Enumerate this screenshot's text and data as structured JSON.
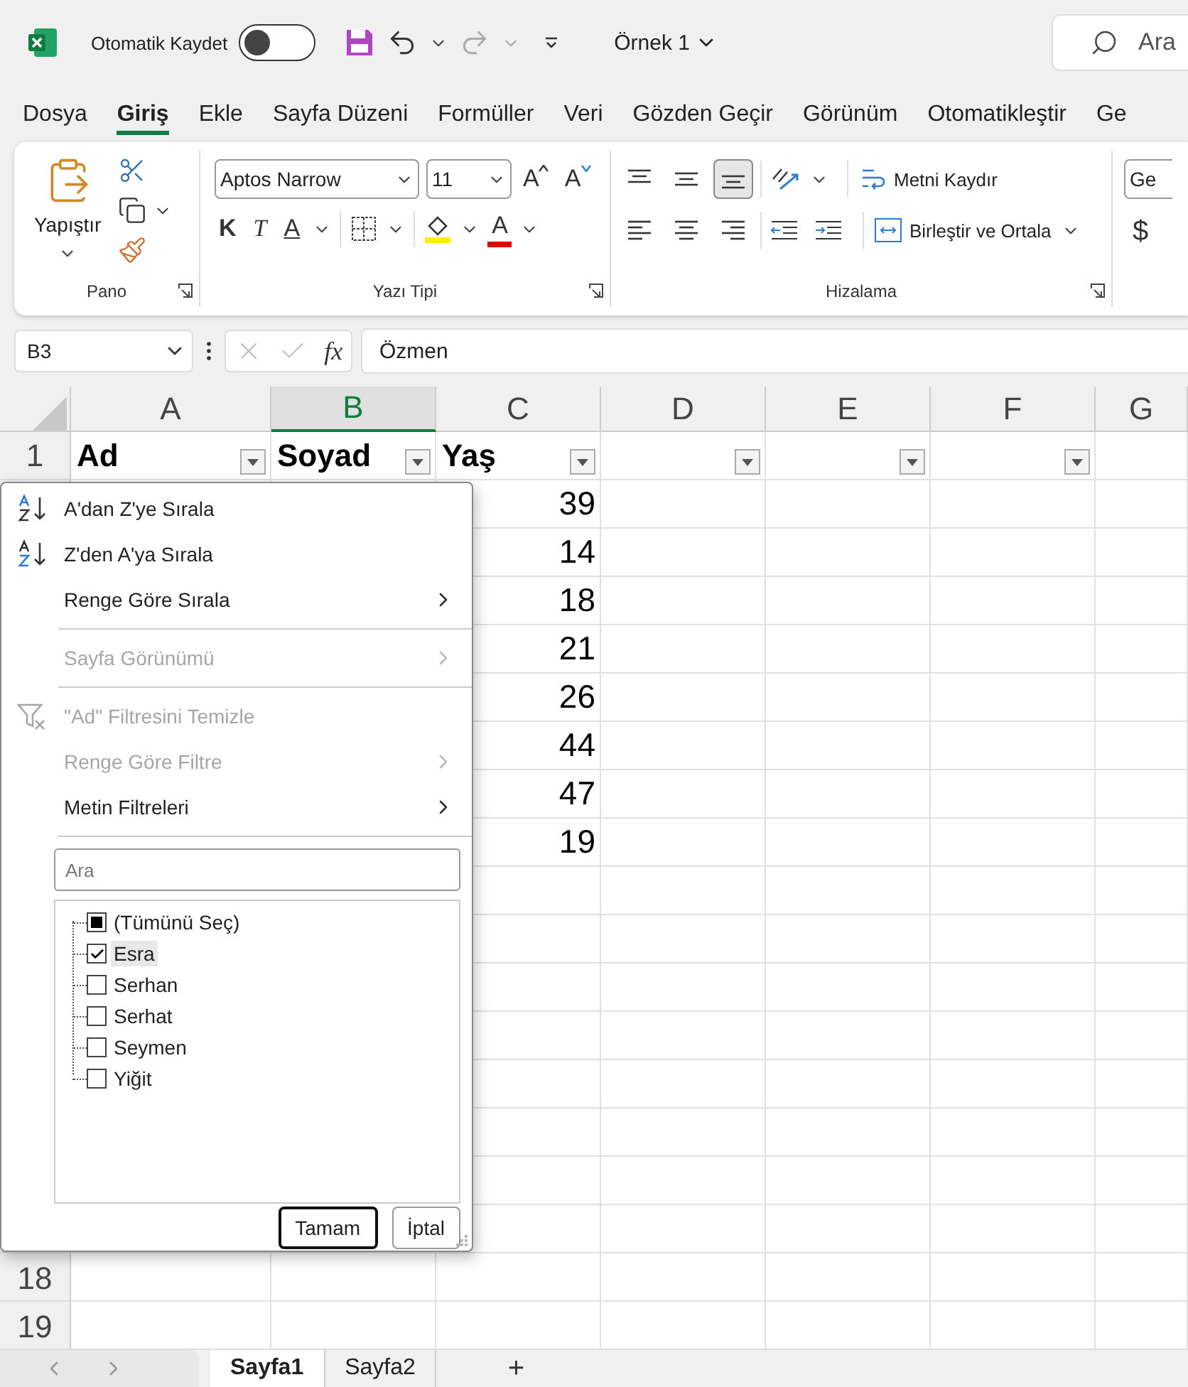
{
  "title_bar": {
    "autosave_label": "Otomatik Kaydet",
    "autosave_on": false,
    "document": "Örnek 1",
    "search_placeholder": "Ara"
  },
  "menu_tabs": [
    {
      "label": "Dosya",
      "selected": false
    },
    {
      "label": "Giriş",
      "selected": true
    },
    {
      "label": "Ekle",
      "selected": false
    },
    {
      "label": "Sayfa Düzeni",
      "selected": false
    },
    {
      "label": "Formüller",
      "selected": false
    },
    {
      "label": "Veri",
      "selected": false
    },
    {
      "label": "Gözden Geçir",
      "selected": false
    },
    {
      "label": "Görünüm",
      "selected": false
    },
    {
      "label": "Otomatikleştir",
      "selected": false
    },
    {
      "label": "Ge",
      "selected": false
    }
  ],
  "ribbon": {
    "clipboard": {
      "paste_label": "Yapıştır",
      "group_label": "Pano"
    },
    "font": {
      "font_name": "Aptos Narrow",
      "font_size": "11",
      "grow_key": "A",
      "shrink_key": "A",
      "bold_key": "K",
      "italic_key": "T",
      "underline_key": "A",
      "color_key": "A",
      "group_label": "Yazı Tipi"
    },
    "alignment": {
      "vertical_buttons": [
        {
          "kind": "top",
          "selected": false
        },
        {
          "kind": "middle",
          "selected": false
        },
        {
          "kind": "bottom",
          "selected": true
        }
      ],
      "horizontal_buttons": [
        {
          "kind": "left",
          "selected": false
        },
        {
          "kind": "center",
          "selected": false
        },
        {
          "kind": "right",
          "selected": false
        }
      ],
      "wrap_label": "Metni Kaydır",
      "merge_label": "Birleştir ve Ortala",
      "group_label": "Hizalama"
    },
    "number": {
      "format": "Ge",
      "currency": "$"
    }
  },
  "formula_bar": {
    "name_box": "B3",
    "function_label": "fx",
    "value": "Özmen"
  },
  "sheet": {
    "columns": [
      {
        "label": "A",
        "selected": false
      },
      {
        "label": "B",
        "selected": true
      },
      {
        "label": "C",
        "selected": false
      },
      {
        "label": "D",
        "selected": false
      },
      {
        "label": "E",
        "selected": false
      },
      {
        "label": "F",
        "selected": false
      },
      {
        "label": "G",
        "selected": false
      }
    ],
    "header_row": {
      "number": "1",
      "cells": [
        {
          "text": "Ad"
        },
        {
          "text": "Soyad"
        },
        {
          "text": "Yaş"
        },
        {},
        {},
        {}
      ]
    },
    "column_c_values": [
      "39",
      "14",
      "18",
      "21",
      "26",
      "44",
      "47",
      "19"
    ],
    "lower_row_numbers": [
      "18",
      "19"
    ]
  },
  "filter_menu": {
    "items": [
      {
        "kind": "sort_ascending",
        "label": "A'dan Z'ye Sırala",
        "disabled": false,
        "submenu": false
      },
      {
        "kind": "sort_descending",
        "label": "Z'den A'ya Sırala",
        "disabled": false,
        "submenu": false
      },
      {
        "kind": "plain",
        "label": "Renge Göre Sırala",
        "disabled": false,
        "submenu": true
      },
      {
        "kind": "divider"
      },
      {
        "kind": "plain",
        "label": "Sayfa Görünümü",
        "disabled": true,
        "submenu": true
      },
      {
        "kind": "divider"
      },
      {
        "kind": "clear_filter",
        "label": "\"Ad\" Filtresini Temizle",
        "disabled": true,
        "submenu": false
      },
      {
        "kind": "plain",
        "label": "Renge Göre Filtre",
        "disabled": true,
        "submenu": true
      },
      {
        "kind": "plain",
        "label": "Metin Filtreleri",
        "disabled": false,
        "submenu": true
      },
      {
        "kind": "divider"
      }
    ],
    "search_placeholder": "Ara",
    "select_all": {
      "label": "(Tümünü Seç)",
      "partial": true
    },
    "checklist": [
      {
        "label": "Esra",
        "checked": true,
        "selected": true
      },
      {
        "label": "Serhan",
        "checked": false,
        "selected": false
      },
      {
        "label": "Serhat",
        "checked": false,
        "selected": false
      },
      {
        "label": "Seymen",
        "checked": false,
        "selected": false
      },
      {
        "label": "Yiğit",
        "checked": false,
        "selected": false
      }
    ],
    "buttons": [
      {
        "label": "Tamam",
        "default": true
      },
      {
        "label": "İptal",
        "default": false
      }
    ]
  },
  "sheet_tabs": {
    "tabs": [
      {
        "label": "Sayfa1",
        "selected": true
      },
      {
        "label": "Sayfa2",
        "selected": false
      }
    ],
    "add_label": "+"
  }
}
